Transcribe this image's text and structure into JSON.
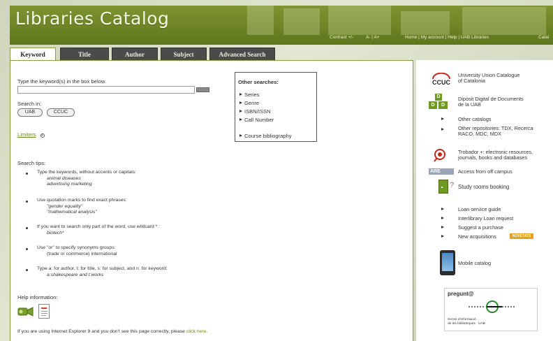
{
  "header": {
    "title": "Libraries Catalog",
    "contrast": "Contrast +/-",
    "font_size": "A- | A+",
    "nav": "Home | My account | Help | UAB Libraries",
    "nav_cut": "Catal"
  },
  "tabs": [
    {
      "label": "Keyword",
      "active": true
    },
    {
      "label": "Title"
    },
    {
      "label": "Author"
    },
    {
      "label": "Subject"
    },
    {
      "label": "Advanced Search"
    }
  ],
  "search": {
    "prompt": "Type the keyword(s) in the box below.",
    "value": "",
    "search_in_label": "Search in:",
    "options": [
      "UAB",
      "CCUC"
    ],
    "limiters": "Limiters"
  },
  "other_searches": {
    "title": "Other searches:",
    "items": [
      "Series",
      "Genre",
      "ISBN/ISSN",
      "Call Number"
    ],
    "extra": "Course bibliography"
  },
  "tips": {
    "title": "Search tips:",
    "items": [
      {
        "text": "Type the keywords, without accents or capitals:",
        "examples": [
          "animal diseases",
          "advertising marketing"
        ]
      },
      {
        "text": "Use quotation marks to find exact phrases:",
        "examples": [
          "\"gender equality\"",
          "\"mathematical analysis\""
        ]
      },
      {
        "text": "If you want to search only part of the word, use wildcard * :",
        "examples": [
          "biotech*"
        ]
      },
      {
        "text": "Use \"or\" to specify synonyms groups:",
        "examples": [
          "(trade or commerce) international"
        ]
      },
      {
        "text": "Type a: for author, t: for title, s: for subject, and n: for keyword:",
        "examples": [
          "a:shakespeare and t:works"
        ]
      }
    ]
  },
  "help": {
    "title": "Help information:",
    "ie_notice": "If you are using Internet Explorer 9 and you don't see this page correctly, please",
    "click_here": "click here."
  },
  "right": {
    "ccuc_logo": "CCUC",
    "ccuc_line1": "University Union Catalogue",
    "ccuc_line2": "of Catalonia",
    "ddd_line1": "Dipòsit Digital de Documents",
    "ddd_line2": "de la UAB",
    "other_catalogs": "Other catalogs",
    "other_repos_line1": "Other repositories: TDX, Recerca",
    "other_repos_line2": "RACO, MDC, MDX",
    "trobador_line1": "Trobador +: electronic resources,",
    "trobador_line2": "journals, books and databases",
    "are_logo": "ARE",
    "off_campus": "Access from off campus",
    "study_rooms": "Study rooms booking",
    "loan_service": "Loan service guide",
    "interlibrary": "Interlibrary Loan request",
    "suggest": "Suggest a purchase",
    "new_acq": "New acquisitions",
    "new_badge": "NOVETATS",
    "mobile": "Mobile catalog",
    "pregunta_title": "pregunt@",
    "pregunta_line1": "Servei d'informació",
    "pregunta_line2": "de les biblioteques · UAB"
  },
  "colors": {
    "brand_green": "#6e8426",
    "link_green": "#6b8a1e",
    "tab_dark": "#4b4b4b"
  }
}
